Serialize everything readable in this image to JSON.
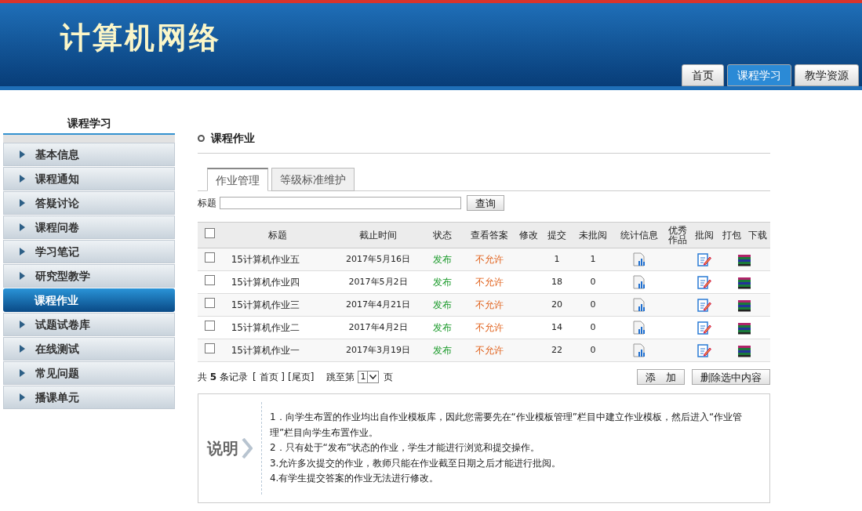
{
  "header": {
    "title": "计算机网络"
  },
  "nav_tabs": [
    {
      "label": "首页",
      "selected": false
    },
    {
      "label": "课程学习",
      "selected": true
    },
    {
      "label": "教学资源",
      "selected": false
    }
  ],
  "sidebar": {
    "title": "课程学习",
    "items": [
      {
        "label": "基本信息",
        "selected": false
      },
      {
        "label": "课程通知",
        "selected": false
      },
      {
        "label": "答疑讨论",
        "selected": false
      },
      {
        "label": "课程问卷",
        "selected": false
      },
      {
        "label": "学习笔记",
        "selected": false
      },
      {
        "label": "研究型教学",
        "selected": false
      },
      {
        "label": "课程作业",
        "selected": true
      },
      {
        "label": "试题试卷库",
        "selected": false
      },
      {
        "label": "在线测试",
        "selected": false
      },
      {
        "label": "常见问题",
        "selected": false
      },
      {
        "label": "播课单元",
        "selected": false
      }
    ]
  },
  "section_title": "课程作业",
  "tabs": [
    {
      "label": "作业管理",
      "selected": true
    },
    {
      "label": "等级标准维护",
      "selected": false
    }
  ],
  "search": {
    "label": "标题",
    "button": "查询"
  },
  "table": {
    "columns": [
      "标题",
      "截止时间",
      "状态",
      "查看答案",
      "修改",
      "提交",
      "未批阅",
      "统计信息",
      "优秀作品",
      "批阅",
      "打包",
      "下载"
    ],
    "header_checked": false,
    "rows": [
      {
        "checked": false,
        "title": "15计算机作业五",
        "deadline": "2017年5月16日",
        "status": "发布",
        "answer": "不允许",
        "submitted": "1",
        "unreviewed": "1"
      },
      {
        "checked": false,
        "title": "15计算机作业四",
        "deadline": "2017年5月2日",
        "status": "发布",
        "answer": "不允许",
        "submitted": "18",
        "unreviewed": "0"
      },
      {
        "checked": false,
        "title": "15计算机作业三",
        "deadline": "2017年4月21日",
        "status": "发布",
        "answer": "不允许",
        "submitted": "20",
        "unreviewed": "0"
      },
      {
        "checked": false,
        "title": "15计算机作业二",
        "deadline": "2017年4月2日",
        "status": "发布",
        "answer": "不允许",
        "submitted": "14",
        "unreviewed": "0"
      },
      {
        "checked": false,
        "title": "15计算机作业一",
        "deadline": "2017年3月19日",
        "status": "发布",
        "answer": "不允许",
        "submitted": "22",
        "unreviewed": "0"
      }
    ]
  },
  "pager": {
    "count": "共 **5** 条记录",
    "first": "[ 首页 ]",
    "last": "[尾页]",
    "jump": "跳至第",
    "page": "1",
    "page_unit": "页"
  },
  "buttons": [
    "添　加",
    "删除选中内容"
  ],
  "note": {
    "label": "说明",
    "lines": [
      "1．向学生布置的作业均出自作业模板库，因此您需要先在“作业模板管理”栏目中建立作业模板，然后进入“作业管理”栏目向学生布置作业。",
      "2．只有处于“发布”状态的作业，学生才能进行浏览和提交操作。",
      "3.允许多次提交的作业，教师只能在作业截至日期之后才能进行批阅。",
      "4.有学生提交答案的作业无法进行修改。"
    ]
  }
}
